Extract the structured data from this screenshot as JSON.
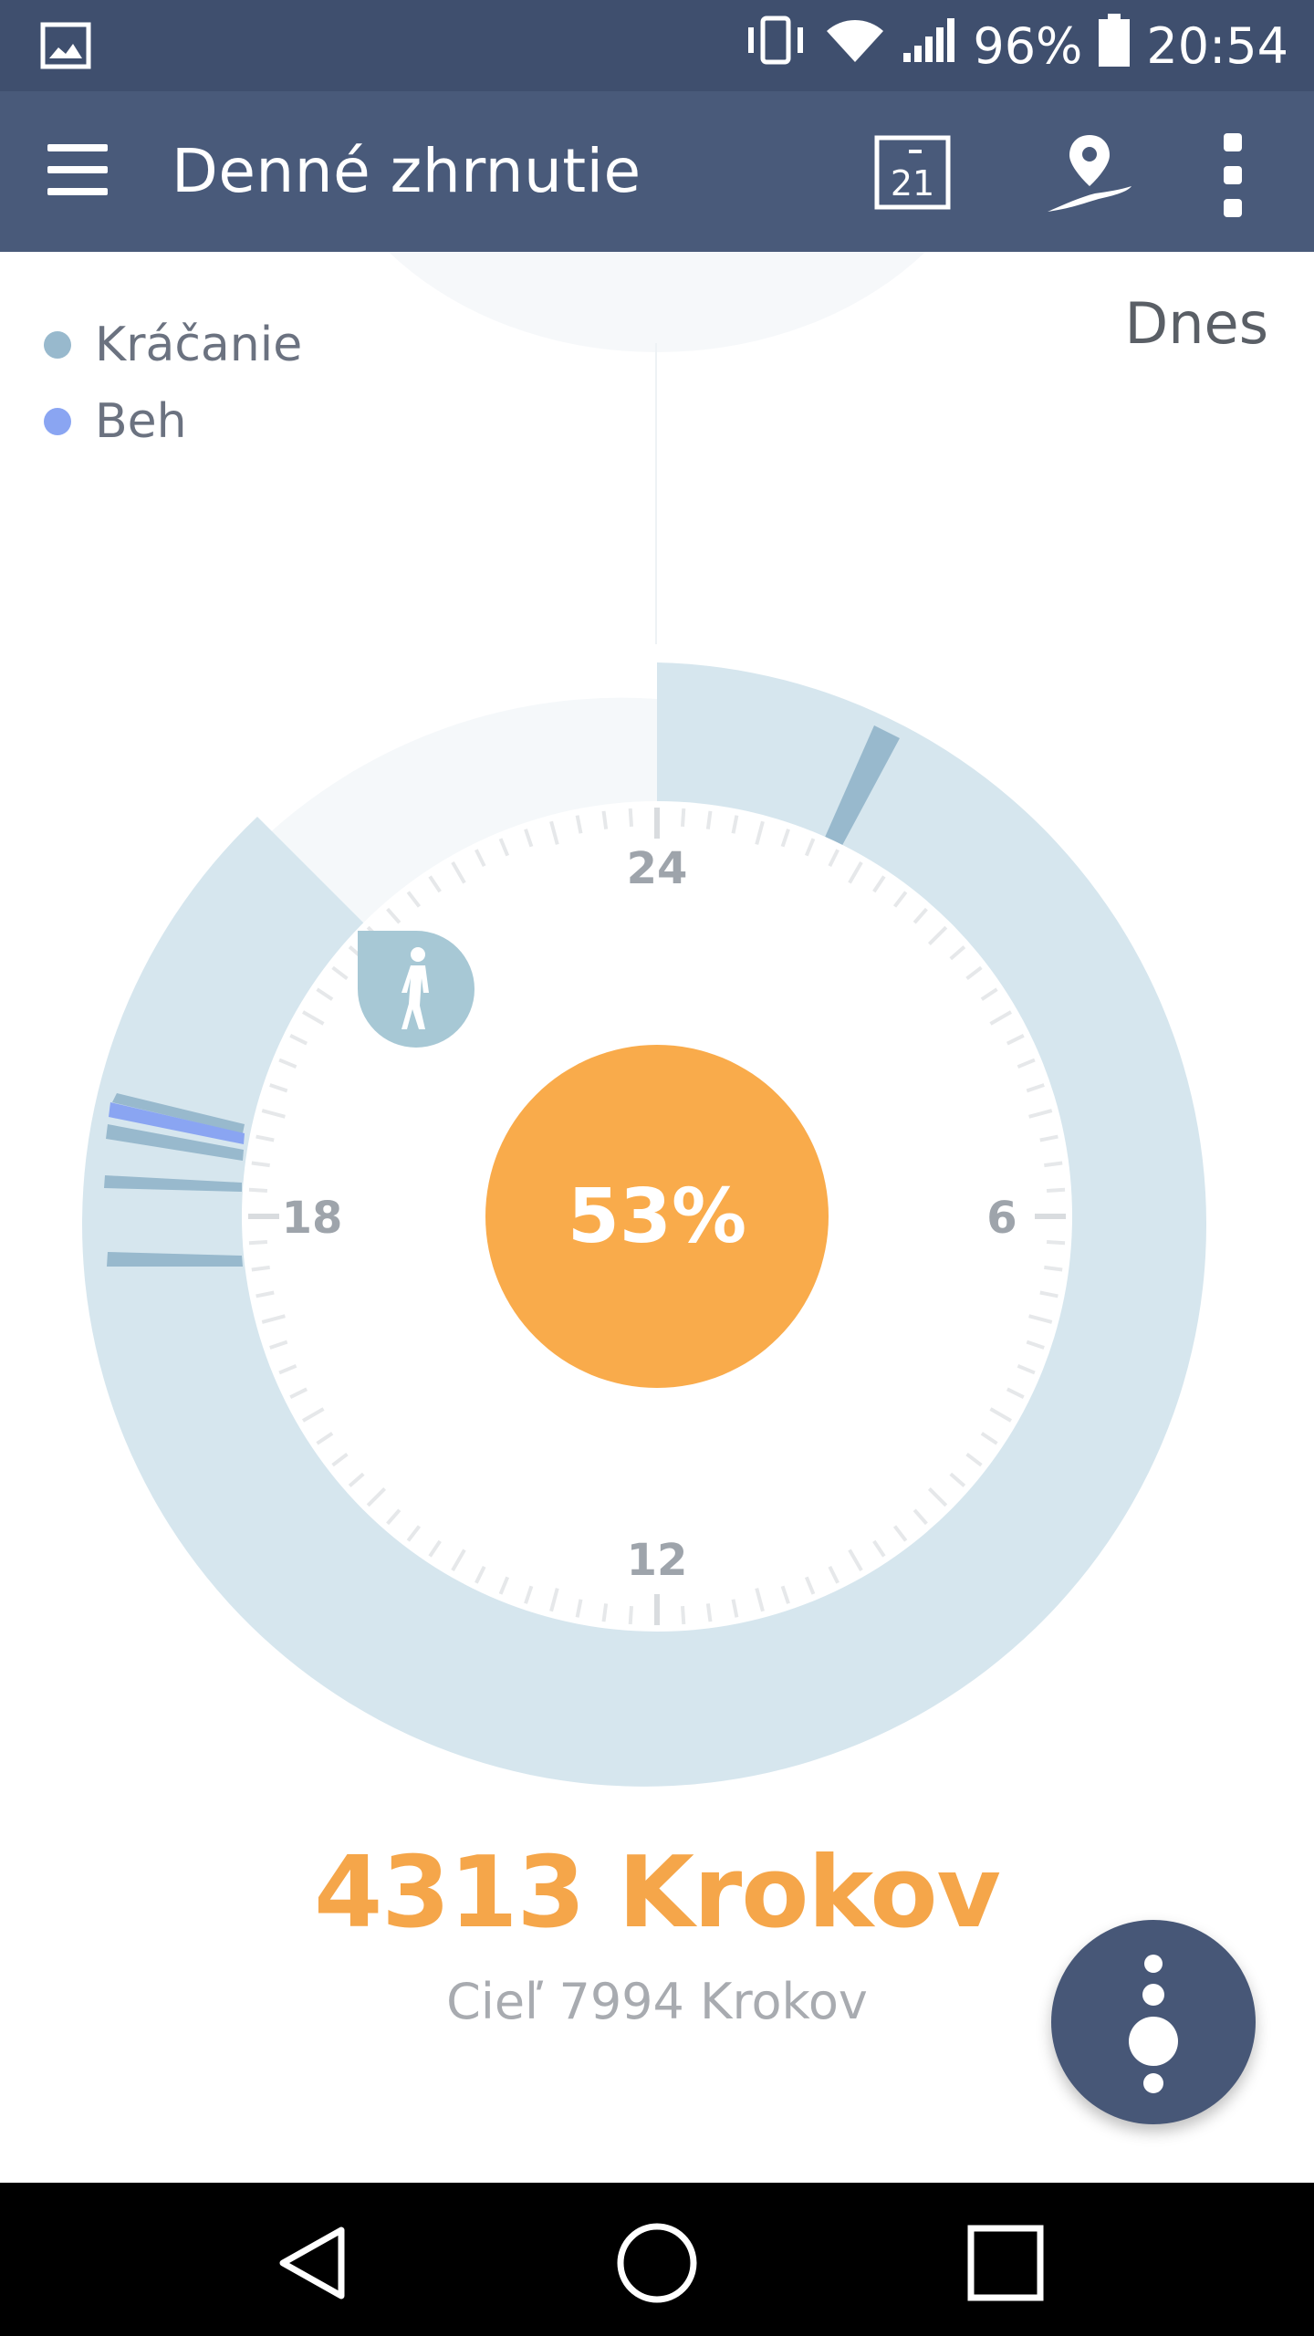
{
  "status_bar": {
    "battery_percent": "96%",
    "time": "20:54",
    "icons": [
      "image-notification-icon",
      "vibrate-icon",
      "wifi-icon",
      "signal-icon",
      "battery-icon"
    ]
  },
  "app_bar": {
    "title": "Denné zhrnutie",
    "calendar_day": "21",
    "icons": [
      "menu-icon",
      "calendar-icon",
      "route-location-icon",
      "more-vert-icon"
    ]
  },
  "legend": {
    "items": [
      {
        "label": "Kráčanie",
        "color": "#98b9cd"
      },
      {
        "label": "Beh",
        "color": "#8aa5f2"
      }
    ]
  },
  "period_label": "Dnes",
  "dial": {
    "hour_labels": [
      "24",
      "6",
      "12",
      "18"
    ],
    "progress_label": "53%",
    "progress_color": "#f9ab4b",
    "ring_color": "#d6e6ee",
    "walk_badge_icon": "walking-person-icon"
  },
  "summary": {
    "steps": "4313 Krokov",
    "goal": "Cieľ 7994 Krokov"
  },
  "fab": {
    "icon": "timeline-dots-icon"
  },
  "nav_bar": {
    "icons": [
      "back-triangle-icon",
      "home-circle-icon",
      "recents-square-icon"
    ]
  }
}
